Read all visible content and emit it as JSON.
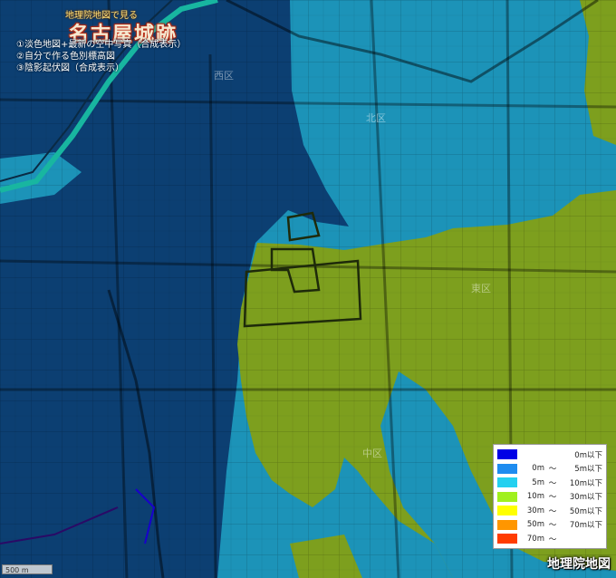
{
  "header": {
    "subtitle": "地理院地図で見る",
    "title": "名古屋城跡",
    "layers": [
      "①淡色地図+最新の空中写真（合成表示）",
      "②自分で作る色別標高図",
      "③陰影起伏図（合成表示）"
    ]
  },
  "wards": {
    "nishi": "西区",
    "kita": "北区",
    "higashi": "東区",
    "naka": "中区"
  },
  "legend": {
    "rows": [
      {
        "color": "#0000e6",
        "low": "",
        "tilde": "",
        "high": "0m以下"
      },
      {
        "color": "#1e8cf0",
        "low": "0m",
        "tilde": "～",
        "high": "5m以下"
      },
      {
        "color": "#24d0f0",
        "low": "5m",
        "tilde": "～",
        "high": "10m以下"
      },
      {
        "color": "#a0f01e",
        "low": "10m",
        "tilde": "～",
        "high": "30m以下"
      },
      {
        "color": "#ffff00",
        "low": "30m",
        "tilde": "～",
        "high": "50m以下"
      },
      {
        "color": "#ff9600",
        "low": "50m",
        "tilde": "～",
        "high": "70m以下"
      },
      {
        "color": "#ff3c00",
        "low": "70m",
        "tilde": "～",
        "high": ""
      }
    ]
  },
  "scale_bar": {
    "label": "500 m"
  },
  "credit": "地理院地図",
  "colors": {
    "below_5m": "#0c3f72",
    "from_5m_to_10m": "#1c93b8",
    "from_10m_to_30m": "#7d9f1e"
  }
}
